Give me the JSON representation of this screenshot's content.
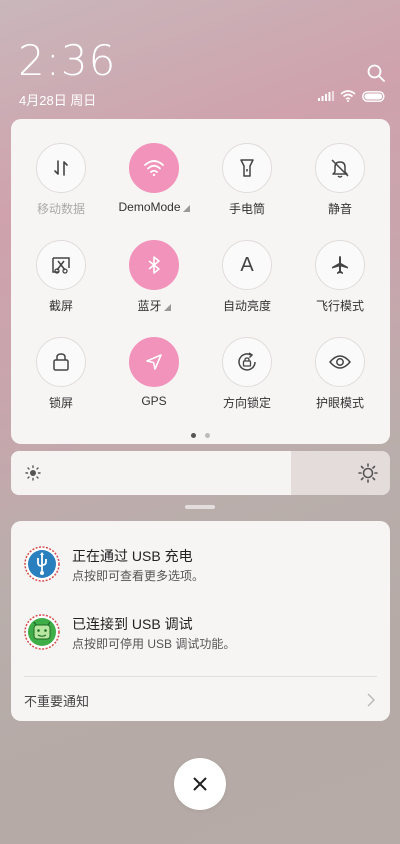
{
  "status": {
    "time": "2:36",
    "date": "4月28日 周日"
  },
  "tiles": [
    {
      "label": "移动数据",
      "icon": "mobile-data-icon",
      "active": false
    },
    {
      "label": "DemoMode",
      "icon": "wifi-icon",
      "active": true
    },
    {
      "label": "手电筒",
      "icon": "flashlight-icon",
      "active": false
    },
    {
      "label": "静音",
      "icon": "mute-bell-icon",
      "active": false
    },
    {
      "label": "截屏",
      "icon": "screenshot-icon",
      "active": false
    },
    {
      "label": "蓝牙",
      "icon": "bluetooth-icon",
      "active": true
    },
    {
      "label": "自动亮度",
      "icon": "auto-brightness-icon",
      "active": false
    },
    {
      "label": "飞行模式",
      "icon": "airplane-icon",
      "active": false
    },
    {
      "label": "锁屏",
      "icon": "lock-icon",
      "active": false
    },
    {
      "label": "GPS",
      "icon": "location-arrow-icon",
      "active": true
    },
    {
      "label": "方向锁定",
      "icon": "rotation-lock-icon",
      "active": false
    },
    {
      "label": "护眼模式",
      "icon": "eye-icon",
      "active": false
    }
  ],
  "tile_icon_text": {
    "auto_brightness": "A"
  },
  "brightness": {
    "level": 0.74
  },
  "notifications": {
    "items": [
      {
        "title": "正在通过 USB 充电",
        "subtitle": "点按即可查看更多选项。",
        "icon": "usb-icon"
      },
      {
        "title": "已连接到 USB 调试",
        "subtitle": "点按即可停用 USB 调试功能。",
        "icon": "android-debug-icon"
      }
    ],
    "more_label": "不重要通知"
  },
  "colors": {
    "accent": "#f193ba"
  }
}
